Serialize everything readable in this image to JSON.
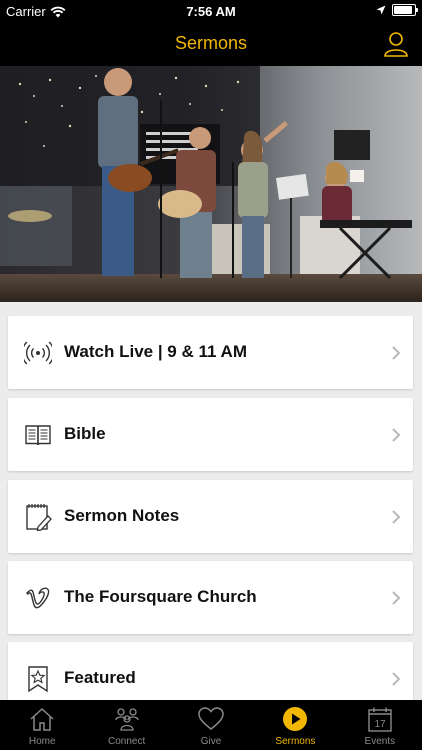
{
  "status_bar": {
    "carrier": "Carrier",
    "time": "7:56 AM"
  },
  "nav": {
    "title": "Sermons"
  },
  "colors": {
    "accent": "#f2b705",
    "bar": "#000000",
    "background": "#ececec"
  },
  "menu": [
    {
      "label": "Watch Live | 9 & 11 AM",
      "icon": "broadcast-icon"
    },
    {
      "label": "Bible",
      "icon": "book-icon"
    },
    {
      "label": "Sermon Notes",
      "icon": "notes-icon"
    },
    {
      "label": "The Foursquare Church",
      "icon": "vimeo-icon"
    },
    {
      "label": "Featured",
      "icon": "bookmark-star-icon"
    }
  ],
  "tabs": [
    {
      "label": "Home",
      "icon": "home-icon"
    },
    {
      "label": "Connect",
      "icon": "people-icon"
    },
    {
      "label": "Give",
      "icon": "heart-icon"
    },
    {
      "label": "Sermons",
      "icon": "play-icon",
      "active": true
    },
    {
      "label": "Events",
      "icon": "calendar-icon",
      "calendar_day": "17"
    }
  ]
}
